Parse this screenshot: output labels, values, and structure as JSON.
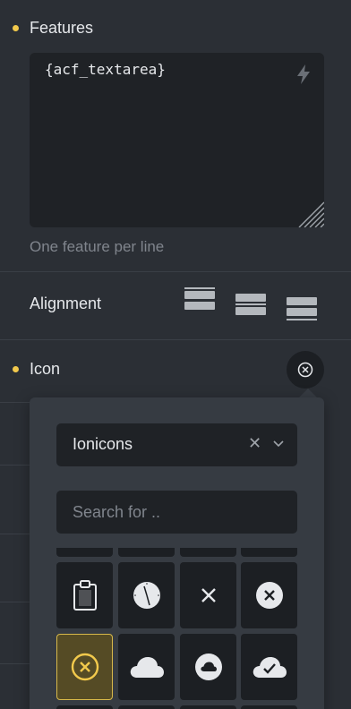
{
  "features": {
    "label": "Features",
    "value": "{acf_textarea}",
    "hint": "One feature per line"
  },
  "alignment": {
    "label": "Alignment",
    "options": [
      "align-top-icon",
      "align-middle-icon",
      "align-bottom-icon"
    ]
  },
  "icon": {
    "label": "Icon",
    "library_select": {
      "value": "Ionicons"
    },
    "search": {
      "placeholder": "Search for .."
    },
    "grid_row1": [
      "clipboard-icon",
      "time-icon",
      "close-icon",
      "close-circle-icon"
    ],
    "grid_row2": [
      "close-circle-outline-icon",
      "cloud-icon",
      "cloud-circle-icon",
      "cloud-done-icon"
    ],
    "selected": "close-circle-outline-icon"
  },
  "colors": {
    "accent": "#f2c94c",
    "panel": "#2b2f35",
    "field": "#1f2226"
  }
}
